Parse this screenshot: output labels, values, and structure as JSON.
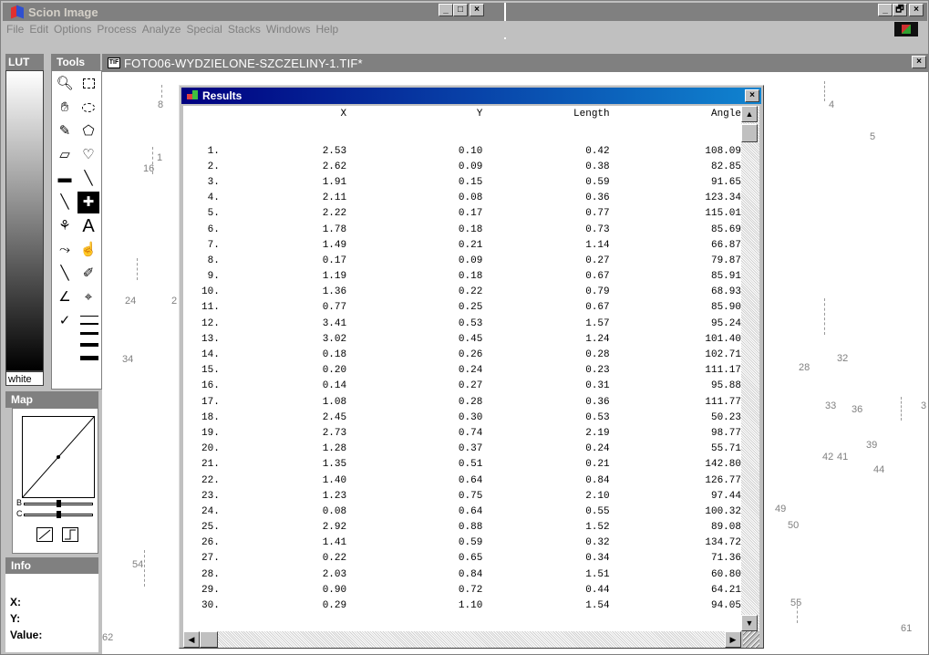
{
  "app": {
    "title": "Scion Image"
  },
  "window_buttons": {
    "minimize": "_",
    "maximize": "□",
    "restore": "🗗",
    "close": "×"
  },
  "menu": [
    "File",
    "Edit",
    "Options",
    "Process",
    "Analyze",
    "Special",
    "Stacks",
    "Windows",
    "Help"
  ],
  "panels": {
    "lut": {
      "title": "LUT",
      "white_label": "white"
    },
    "tools": {
      "title": "Tools"
    },
    "map": {
      "title": "Map",
      "b_label": "B",
      "c_label": "C"
    },
    "info": {
      "title": "Info",
      "x_label": "X:",
      "y_label": "Y:",
      "value_label": "Value:"
    }
  },
  "image_window": {
    "title": "FOTO06-WYDZIELONE-SZCZELINY-1.TIF*",
    "file_icon": "TIF",
    "labels": [
      "8",
      "16",
      "1",
      "24",
      "2",
      "34",
      "54",
      "62",
      "4",
      "5",
      "28",
      "32",
      "33",
      "36",
      "3",
      "39",
      "42",
      "41",
      "44",
      "49",
      "50",
      "55",
      "61"
    ]
  },
  "results": {
    "title": "Results",
    "columns": [
      "",
      "X",
      "Y",
      "Length",
      "Angle"
    ],
    "rows": [
      [
        "1.",
        "2.53",
        "0.10",
        "0.42",
        "108.09"
      ],
      [
        "2.",
        "2.62",
        "0.09",
        "0.38",
        "82.85"
      ],
      [
        "3.",
        "1.91",
        "0.15",
        "0.59",
        "91.65"
      ],
      [
        "4.",
        "2.11",
        "0.08",
        "0.36",
        "123.34"
      ],
      [
        "5.",
        "2.22",
        "0.17",
        "0.77",
        "115.01"
      ],
      [
        "6.",
        "1.78",
        "0.18",
        "0.73",
        "85.69"
      ],
      [
        "7.",
        "1.49",
        "0.21",
        "1.14",
        "66.87"
      ],
      [
        "8.",
        "0.17",
        "0.09",
        "0.27",
        "79.87"
      ],
      [
        "9.",
        "1.19",
        "0.18",
        "0.67",
        "85.91"
      ],
      [
        "10.",
        "1.36",
        "0.22",
        "0.79",
        "68.93"
      ],
      [
        "11.",
        "0.77",
        "0.25",
        "0.67",
        "85.90"
      ],
      [
        "12.",
        "3.41",
        "0.53",
        "1.57",
        "95.24"
      ],
      [
        "13.",
        "3.02",
        "0.45",
        "1.24",
        "101.40"
      ],
      [
        "14.",
        "0.18",
        "0.26",
        "0.28",
        "102.71"
      ],
      [
        "15.",
        "0.20",
        "0.24",
        "0.23",
        "111.17"
      ],
      [
        "16.",
        "0.14",
        "0.27",
        "0.31",
        "95.88"
      ],
      [
        "17.",
        "1.08",
        "0.28",
        "0.36",
        "111.77"
      ],
      [
        "18.",
        "2.45",
        "0.30",
        "0.53",
        "50.23"
      ],
      [
        "19.",
        "2.73",
        "0.74",
        "2.19",
        "98.77"
      ],
      [
        "20.",
        "1.28",
        "0.37",
        "0.24",
        "55.71"
      ],
      [
        "21.",
        "1.35",
        "0.51",
        "0.21",
        "142.80"
      ],
      [
        "22.",
        "1.40",
        "0.64",
        "0.84",
        "126.77"
      ],
      [
        "23.",
        "1.23",
        "0.75",
        "2.10",
        "97.44"
      ],
      [
        "24.",
        "0.08",
        "0.64",
        "0.55",
        "100.32"
      ],
      [
        "25.",
        "2.92",
        "0.88",
        "1.52",
        "89.08"
      ],
      [
        "26.",
        "1.41",
        "0.59",
        "0.32",
        "134.72"
      ],
      [
        "27.",
        "0.22",
        "0.65",
        "0.34",
        "71.36"
      ],
      [
        "28.",
        "2.03",
        "0.84",
        "1.51",
        "60.80"
      ],
      [
        "29.",
        "0.90",
        "0.72",
        "0.44",
        "64.21"
      ],
      [
        "30.",
        "0.29",
        "1.10",
        "1.54",
        "94.05"
      ]
    ]
  },
  "tool_icons": [
    "magnifier-icon",
    "rect-select-icon",
    "hand-icon",
    "oval-select-icon",
    "pencil-icon",
    "polygon-select-icon",
    "eraser-icon",
    "freehand-select-icon",
    "paint-bucket-icon",
    "wand-icon",
    "line-icon",
    "crosshair-plus-icon",
    "spray-icon",
    "text-icon",
    "scroll-icon",
    "grabber-icon",
    "angle-icon",
    "eyedropper-icon",
    "angle-measure-icon",
    "point-icon",
    "check-icon",
    "line-width-icon"
  ],
  "colors": {
    "titlebar_active_start": "#000080",
    "titlebar_active_end": "#1084d0",
    "titlebar_inactive": "#808080",
    "face": "#c0c0c0"
  }
}
